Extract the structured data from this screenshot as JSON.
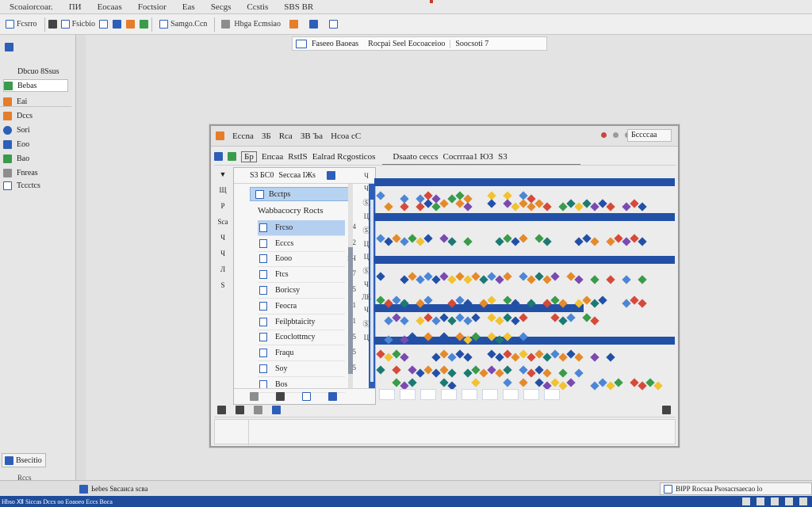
{
  "menu": [
    "Scoaiorcoar.",
    "ПИ",
    "Eocaas",
    "Foctsior",
    "Eas",
    "Secgs",
    "Ccstis",
    "SBS BR"
  ],
  "toolbar": {
    "items": [
      {
        "label": "Fcsrro",
        "icon": "document-icon"
      },
      {
        "label": "Fsicbio",
        "icon": "page-icon"
      },
      {
        "label": "",
        "icon": "brush-icon"
      },
      {
        "label": "Samgo.Ccn",
        "icon": "window-icon"
      },
      {
        "label": "Hbga Ecmsiao",
        "icon": "shield-icon"
      }
    ]
  },
  "subtoolbar": {
    "left": "Faseeo Baoeas",
    "middle": "Rocpai Seel Eocoaceioo",
    "right": "Soocsoti 7"
  },
  "leftbar": {
    "items": [
      "Dbcuo 8Ssus",
      "Bebas",
      "Eai",
      "Dccs",
      "Sori",
      "Eoo",
      "Bao",
      "Fnreas",
      "Tccctcs"
    ],
    "bottom_button": "Bsecitio",
    "bottom_small": "Rccs"
  },
  "dialog": {
    "title_items": [
      "Eccna",
      "ЗБ",
      "Rca",
      "ЗВ Ъа",
      "Нсоа сС"
    ],
    "search": "Бссссаа",
    "toolbar_items": [
      "Бр",
      "Епсаа",
      "RstIS",
      "Ealrad Rcgosticos",
      "Dsaato ceccs",
      "Cocrrraa1 ЮЗ",
      "S3"
    ],
    "panel_header": [
      "S3 БС0",
      "Seccaa IЖs"
    ],
    "panel_find": "Bcctps",
    "panel_group": "Wabbacocry Rocts",
    "panel_items": [
      {
        "label": "Frcso",
        "num": "14"
      },
      {
        "label": "Ecccs",
        "num": "12"
      },
      {
        "label": "Eooo",
        "num": "ЅЧ"
      },
      {
        "label": "Ftcs",
        "num": "7"
      },
      {
        "label": "Boricsy",
        "num": "5"
      },
      {
        "label": "Feocra",
        "num": "1"
      },
      {
        "label": "Feilpbtaicity",
        "num": "1"
      },
      {
        "label": "Ecoclottmcy",
        "num": "15"
      },
      {
        "label": "Fraqu",
        "num": "5"
      },
      {
        "label": "Soy",
        "num": "5"
      },
      {
        "label": "Bos",
        "num": ""
      }
    ],
    "left_strip": [
      "▼",
      "Щ",
      "Р",
      "Sca",
      "Ч",
      "Ч",
      "Л",
      "Ѕ"
    ],
    "mid_strip": [
      "Ч",
      "Ч",
      "Ⓢ",
      "Ц",
      "Ⓢ",
      "Ц",
      "Ц",
      "Ⓢ",
      "Ч",
      "ЛЕ",
      "Ч",
      "Ⓢ",
      "Ц"
    ]
  },
  "status": {
    "left": "Ьеbes Ѕвсаиса ѕсва",
    "right": "BⅠPP Rocsaa Psosacrsaecao lo"
  },
  "taskbar": {
    "text": "Hbso Ⅻ Siccas   Dccs oo Eoaoeo Eccs Boca"
  },
  "colors": {
    "accent": "#2350a7",
    "selection": "#b4cff0",
    "taskbar": "#1e4c9a"
  }
}
